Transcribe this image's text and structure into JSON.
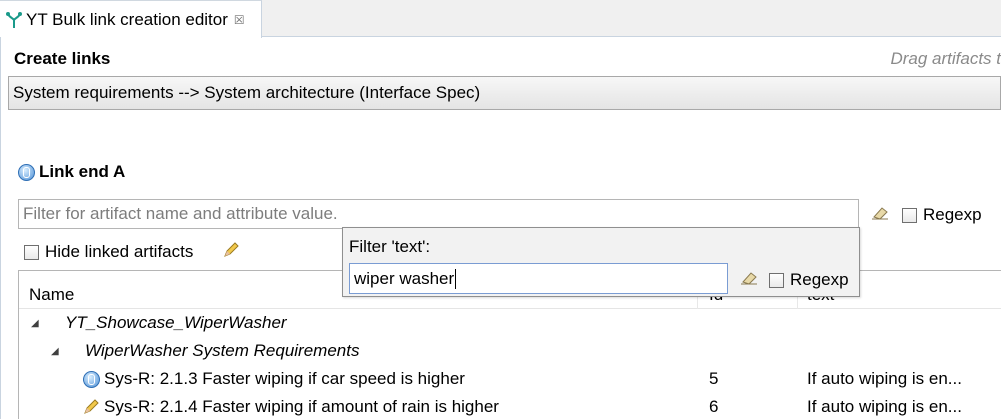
{
  "tab": {
    "title": "YT Bulk link creation editor",
    "close_glyph": "☒",
    "icon": "link-editor-icon"
  },
  "section": {
    "title": "Create links",
    "drag_hint": "Drag artifacts t"
  },
  "link_type_combo": {
    "value": "System requirements --> System architecture (Interface Spec)"
  },
  "link_end": {
    "label": "Link end A",
    "filter_placeholder": "Filter for artifact name and attribute value.",
    "regexp_label": "Regexp",
    "hide_linked_label": "Hide linked artifacts"
  },
  "table": {
    "columns": {
      "name": "Name",
      "id": "Id",
      "text": "text"
    },
    "rows": [
      {
        "name": "YT_Showcase_WiperWasher",
        "id": "",
        "text": "",
        "level": 0,
        "italic": true,
        "icon": ""
      },
      {
        "name": "WiperWasher System Requirements",
        "id": "",
        "text": "",
        "level": 1,
        "italic": true,
        "icon": ""
      },
      {
        "name": "Sys-R: 2.1.3 Faster wiping if car speed is higher",
        "id": "5",
        "text": "If auto wiping is en...",
        "level": 2,
        "italic": false,
        "icon": "info-icon"
      },
      {
        "name": "Sys-R: 2.1.4 Faster wiping if amount of rain is higher",
        "id": "6",
        "text": "If auto wiping is en...",
        "level": 2,
        "italic": false,
        "icon": "pencil-icon"
      }
    ]
  },
  "popup": {
    "title": "Filter 'text':",
    "value": "wiper washer",
    "regexp_label": "Regexp"
  },
  "colors": {
    "accent": "#4b8fd6",
    "border": "#b5b5b5",
    "hint": "#8a8a8a"
  }
}
